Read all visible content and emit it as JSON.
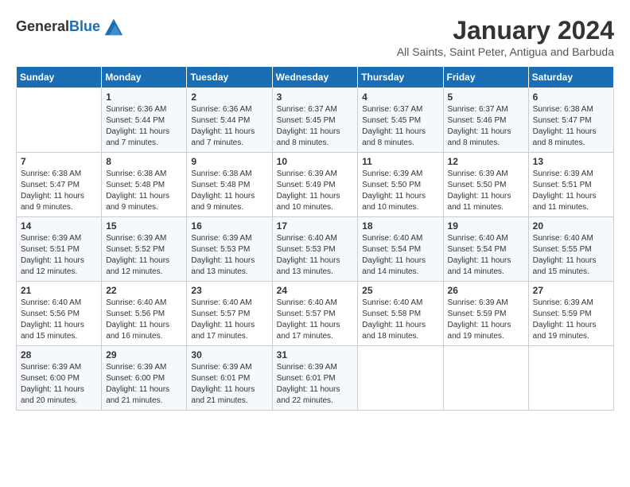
{
  "logo": {
    "text_general": "General",
    "text_blue": "Blue"
  },
  "title": "January 2024",
  "subtitle": "All Saints, Saint Peter, Antigua and Barbuda",
  "days_of_week": [
    "Sunday",
    "Monday",
    "Tuesday",
    "Wednesday",
    "Thursday",
    "Friday",
    "Saturday"
  ],
  "weeks": [
    [
      {
        "day": "",
        "info": ""
      },
      {
        "day": "1",
        "info": "Sunrise: 6:36 AM\nSunset: 5:44 PM\nDaylight: 11 hours\nand 7 minutes."
      },
      {
        "day": "2",
        "info": "Sunrise: 6:36 AM\nSunset: 5:44 PM\nDaylight: 11 hours\nand 7 minutes."
      },
      {
        "day": "3",
        "info": "Sunrise: 6:37 AM\nSunset: 5:45 PM\nDaylight: 11 hours\nand 8 minutes."
      },
      {
        "day": "4",
        "info": "Sunrise: 6:37 AM\nSunset: 5:45 PM\nDaylight: 11 hours\nand 8 minutes."
      },
      {
        "day": "5",
        "info": "Sunrise: 6:37 AM\nSunset: 5:46 PM\nDaylight: 11 hours\nand 8 minutes."
      },
      {
        "day": "6",
        "info": "Sunrise: 6:38 AM\nSunset: 5:47 PM\nDaylight: 11 hours\nand 8 minutes."
      }
    ],
    [
      {
        "day": "7",
        "info": "Sunrise: 6:38 AM\nSunset: 5:47 PM\nDaylight: 11 hours\nand 9 minutes."
      },
      {
        "day": "8",
        "info": "Sunrise: 6:38 AM\nSunset: 5:48 PM\nDaylight: 11 hours\nand 9 minutes."
      },
      {
        "day": "9",
        "info": "Sunrise: 6:38 AM\nSunset: 5:48 PM\nDaylight: 11 hours\nand 9 minutes."
      },
      {
        "day": "10",
        "info": "Sunrise: 6:39 AM\nSunset: 5:49 PM\nDaylight: 11 hours\nand 10 minutes."
      },
      {
        "day": "11",
        "info": "Sunrise: 6:39 AM\nSunset: 5:50 PM\nDaylight: 11 hours\nand 10 minutes."
      },
      {
        "day": "12",
        "info": "Sunrise: 6:39 AM\nSunset: 5:50 PM\nDaylight: 11 hours\nand 11 minutes."
      },
      {
        "day": "13",
        "info": "Sunrise: 6:39 AM\nSunset: 5:51 PM\nDaylight: 11 hours\nand 11 minutes."
      }
    ],
    [
      {
        "day": "14",
        "info": "Sunrise: 6:39 AM\nSunset: 5:51 PM\nDaylight: 11 hours\nand 12 minutes."
      },
      {
        "day": "15",
        "info": "Sunrise: 6:39 AM\nSunset: 5:52 PM\nDaylight: 11 hours\nand 12 minutes."
      },
      {
        "day": "16",
        "info": "Sunrise: 6:39 AM\nSunset: 5:53 PM\nDaylight: 11 hours\nand 13 minutes."
      },
      {
        "day": "17",
        "info": "Sunrise: 6:40 AM\nSunset: 5:53 PM\nDaylight: 11 hours\nand 13 minutes."
      },
      {
        "day": "18",
        "info": "Sunrise: 6:40 AM\nSunset: 5:54 PM\nDaylight: 11 hours\nand 14 minutes."
      },
      {
        "day": "19",
        "info": "Sunrise: 6:40 AM\nSunset: 5:54 PM\nDaylight: 11 hours\nand 14 minutes."
      },
      {
        "day": "20",
        "info": "Sunrise: 6:40 AM\nSunset: 5:55 PM\nDaylight: 11 hours\nand 15 minutes."
      }
    ],
    [
      {
        "day": "21",
        "info": "Sunrise: 6:40 AM\nSunset: 5:56 PM\nDaylight: 11 hours\nand 15 minutes."
      },
      {
        "day": "22",
        "info": "Sunrise: 6:40 AM\nSunset: 5:56 PM\nDaylight: 11 hours\nand 16 minutes."
      },
      {
        "day": "23",
        "info": "Sunrise: 6:40 AM\nSunset: 5:57 PM\nDaylight: 11 hours\nand 17 minutes."
      },
      {
        "day": "24",
        "info": "Sunrise: 6:40 AM\nSunset: 5:57 PM\nDaylight: 11 hours\nand 17 minutes."
      },
      {
        "day": "25",
        "info": "Sunrise: 6:40 AM\nSunset: 5:58 PM\nDaylight: 11 hours\nand 18 minutes."
      },
      {
        "day": "26",
        "info": "Sunrise: 6:39 AM\nSunset: 5:59 PM\nDaylight: 11 hours\nand 19 minutes."
      },
      {
        "day": "27",
        "info": "Sunrise: 6:39 AM\nSunset: 5:59 PM\nDaylight: 11 hours\nand 19 minutes."
      }
    ],
    [
      {
        "day": "28",
        "info": "Sunrise: 6:39 AM\nSunset: 6:00 PM\nDaylight: 11 hours\nand 20 minutes."
      },
      {
        "day": "29",
        "info": "Sunrise: 6:39 AM\nSunset: 6:00 PM\nDaylight: 11 hours\nand 21 minutes."
      },
      {
        "day": "30",
        "info": "Sunrise: 6:39 AM\nSunset: 6:01 PM\nDaylight: 11 hours\nand 21 minutes."
      },
      {
        "day": "31",
        "info": "Sunrise: 6:39 AM\nSunset: 6:01 PM\nDaylight: 11 hours\nand 22 minutes."
      },
      {
        "day": "",
        "info": ""
      },
      {
        "day": "",
        "info": ""
      },
      {
        "day": "",
        "info": ""
      }
    ]
  ]
}
